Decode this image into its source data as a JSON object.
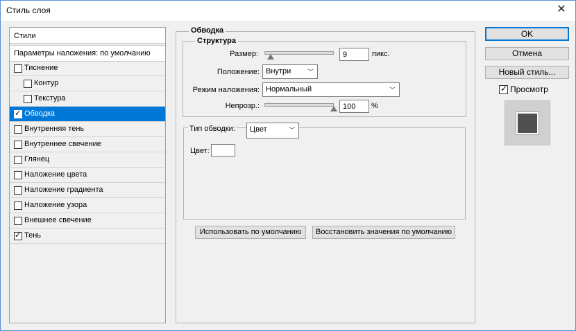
{
  "window": {
    "title": "Стиль слоя"
  },
  "styles": {
    "header": "Стили",
    "blending": "Параметры наложения: по умолчанию",
    "items": [
      {
        "label": "Тиснение",
        "checked": false,
        "indent": false,
        "selected": false
      },
      {
        "label": "Контур",
        "checked": false,
        "indent": true,
        "selected": false
      },
      {
        "label": "Текстура",
        "checked": false,
        "indent": true,
        "selected": false
      },
      {
        "label": "Обводка",
        "checked": true,
        "indent": false,
        "selected": true
      },
      {
        "label": "Внутренняя тень",
        "checked": false,
        "indent": false,
        "selected": false
      },
      {
        "label": "Внутреннее свечение",
        "checked": false,
        "indent": false,
        "selected": false
      },
      {
        "label": "Глянец",
        "checked": false,
        "indent": false,
        "selected": false
      },
      {
        "label": "Наложение цвета",
        "checked": false,
        "indent": false,
        "selected": false
      },
      {
        "label": "Наложение градиента",
        "checked": false,
        "indent": false,
        "selected": false
      },
      {
        "label": "Наложение узора",
        "checked": false,
        "indent": false,
        "selected": false
      },
      {
        "label": "Внешнее свечение",
        "checked": false,
        "indent": false,
        "selected": false
      },
      {
        "label": "Тень",
        "checked": true,
        "indent": false,
        "selected": false
      }
    ]
  },
  "stroke": {
    "title": "Обводка",
    "structure": {
      "title": "Структура",
      "size_label": "Размер:",
      "size_value": "9",
      "size_unit": "пикс.",
      "position_label": "Положение:",
      "position_value": "Внутри",
      "blend_label": "Режим наложения:",
      "blend_value": "Нормальный",
      "opacity_label": "Непрозр.:",
      "opacity_value": "100",
      "opacity_unit": "%"
    },
    "fill": {
      "type_label": "Тип обводки:",
      "type_value": "Цвет",
      "color_label": "Цвет:",
      "color": "#ffffff"
    },
    "make_default": "Использовать по умолчанию",
    "reset_default": "Восстановить значения по умолчанию"
  },
  "buttons": {
    "ok": "OK",
    "cancel": "Отмена",
    "new_style": "Новый стиль...",
    "preview_label": "Просмотр",
    "preview_checked": true
  },
  "colors": {
    "selection": "#0078d7",
    "preview_fill": "#505050"
  }
}
